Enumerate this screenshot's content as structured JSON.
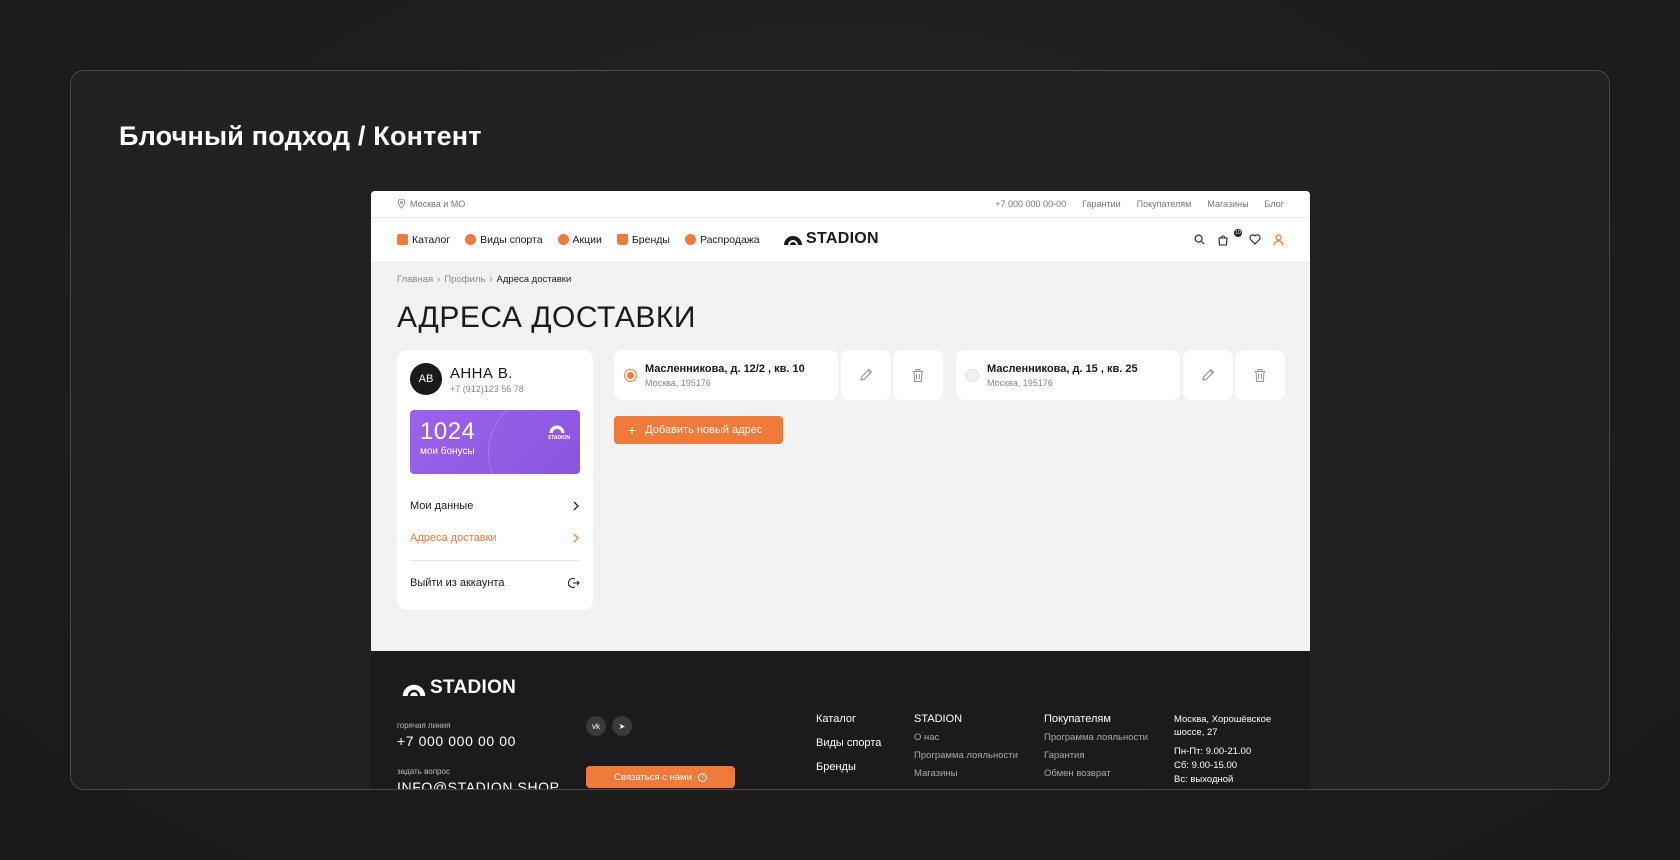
{
  "frame": {
    "title": "Блочный подход / Контент"
  },
  "topbar": {
    "location": "Москва и МО",
    "links": [
      "+7 000 000 00-00",
      "Гарантии",
      "Покупателям",
      "Магазины",
      "Блог"
    ]
  },
  "nav": {
    "items": [
      "Каталог",
      "Виды спорта",
      "Акции",
      "Бренды",
      "Распродажа"
    ],
    "logo": "STADION",
    "cart_count": "10"
  },
  "breadcrumb": [
    "Главная",
    "Профиль",
    "Адреса доставки"
  ],
  "page_title": "АДРЕСА ДОСТАВКИ",
  "profile": {
    "initials": "АВ",
    "name": "АННА В.",
    "phone": "+7 (912)123 56 78",
    "bonus_value": "1024",
    "bonus_label": "мои бонусы",
    "bonus_logo": "STADION",
    "menu": [
      "Мои данные",
      "Адреса доставки",
      "Выйти из аккаунта"
    ]
  },
  "addresses": [
    {
      "title": "Масленникова, д. 12/2 , кв. 10",
      "city": "Москва, 195176",
      "selected": true
    },
    {
      "title": "Масленникова, д. 15 , кв. 25",
      "city": "Москва, 195176",
      "selected": false
    }
  ],
  "add_address_label": "Добавить новый адрес",
  "footer": {
    "logo": "STADION",
    "hotline_label": "горячая линия",
    "hotline": "+7 000 000 00 00",
    "ask_label": "задать вопрос",
    "email": "INFO@STADION.SHOP",
    "socials": [
      "vk",
      "tg"
    ],
    "contact_button": "Связаться с нами",
    "col1": [
      "Каталог",
      "Виды спорта",
      "Бренды"
    ],
    "col2_head": "STADION",
    "col2": [
      "О нас",
      "Программа лояльности",
      "Магазины"
    ],
    "col3_head": "Покупателям",
    "col3": [
      "Программа лояльности",
      "Гарантия",
      "Обмен возврат"
    ],
    "address": "Москва, Хорошёвское шоссе, 27",
    "hours": [
      "Пн-Пт: 9.00-21.00",
      "Сб: 9.00-15.00",
      "Вс: выходной"
    ]
  },
  "colors": {
    "accent": "#f07a3a",
    "bonus": "#9b63ea",
    "dark": "#1b1b1d"
  }
}
